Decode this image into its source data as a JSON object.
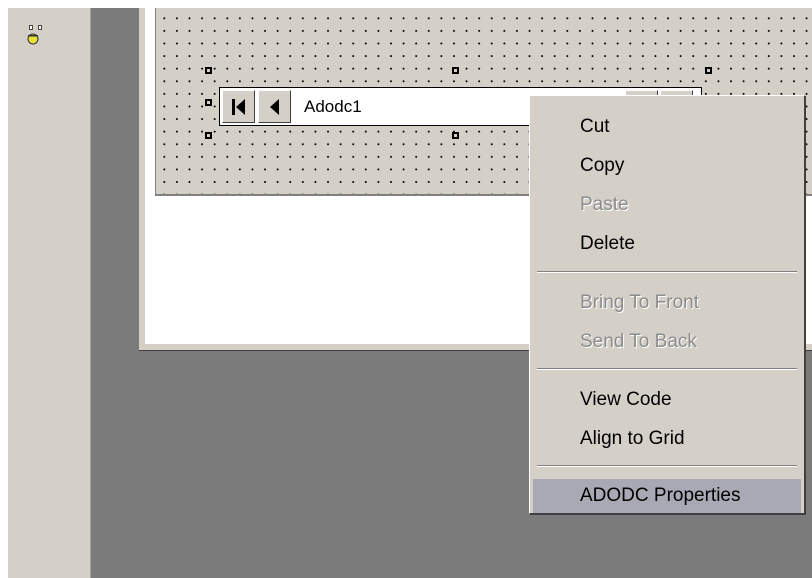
{
  "control": {
    "caption": "Adodc1"
  },
  "context_menu": {
    "items": [
      {
        "label": "Cut",
        "enabled": true
      },
      {
        "label": "Copy",
        "enabled": true
      },
      {
        "label": "Paste",
        "enabled": false
      },
      {
        "label": "Delete",
        "enabled": true
      },
      {
        "label": "Bring To Front",
        "enabled": false
      },
      {
        "label": "Send To Back",
        "enabled": false
      },
      {
        "label": "View Code",
        "enabled": true
      },
      {
        "label": "Align to Grid",
        "enabled": true
      },
      {
        "label": "ADODC Properties",
        "enabled": true,
        "selected": true
      }
    ]
  },
  "icons": {
    "toolbox_tool": "adodc-tool-icon",
    "nav_first": "first-record-icon",
    "nav_prev": "previous-record-icon"
  },
  "colors": {
    "workspace": "#7b7b7b",
    "face": "#d4d0c8",
    "menu_highlight": "#a9a9b5",
    "disabled_text": "#8c8c8c"
  }
}
